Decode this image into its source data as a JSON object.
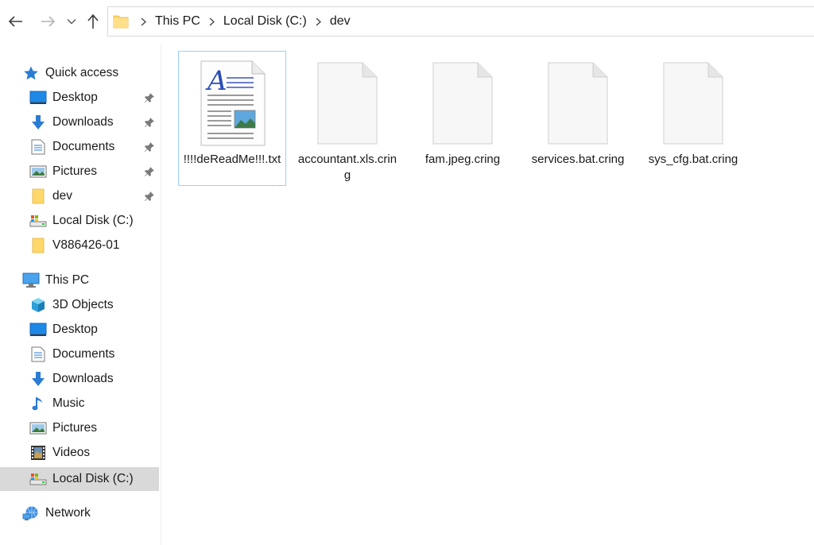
{
  "navigation": {
    "back_label": "Back",
    "forward_label": "Forward",
    "recent_label": "Recent locations",
    "up_label": "Up"
  },
  "address": {
    "crumbs": [
      "This PC",
      "Local Disk (C:)",
      "dev"
    ]
  },
  "sidebar": {
    "quick_access": {
      "label": "Quick access",
      "items": [
        {
          "label": "Desktop",
          "icon": "desktop-icon",
          "pinned": true
        },
        {
          "label": "Downloads",
          "icon": "downloads-icon",
          "pinned": true
        },
        {
          "label": "Documents",
          "icon": "documents-icon",
          "pinned": true
        },
        {
          "label": "Pictures",
          "icon": "pictures-icon",
          "pinned": true
        },
        {
          "label": "dev",
          "icon": "folder-icon",
          "pinned": true
        },
        {
          "label": "Local Disk (C:)",
          "icon": "drive-icon",
          "pinned": false
        },
        {
          "label": "V886426-01",
          "icon": "folder-icon",
          "pinned": false
        }
      ]
    },
    "this_pc": {
      "label": "This PC",
      "items": [
        {
          "label": "3D Objects",
          "icon": "3d-objects-icon"
        },
        {
          "label": "Desktop",
          "icon": "desktop-icon"
        },
        {
          "label": "Documents",
          "icon": "documents-icon"
        },
        {
          "label": "Downloads",
          "icon": "downloads-icon"
        },
        {
          "label": "Music",
          "icon": "music-icon"
        },
        {
          "label": "Pictures",
          "icon": "pictures-icon"
        },
        {
          "label": "Videos",
          "icon": "videos-icon"
        },
        {
          "label": "Local Disk (C:)",
          "icon": "drive-icon",
          "selected": true
        }
      ]
    },
    "network": {
      "label": "Network"
    }
  },
  "files": [
    {
      "name": "!!!!deReadMe!!!.txt",
      "icon": "text-document-icon",
      "selected": true
    },
    {
      "name": "accountant.xls.cring",
      "icon": "blank-file-icon",
      "selected": false
    },
    {
      "name": "fam.jpeg.cring",
      "icon": "blank-file-icon",
      "selected": false
    },
    {
      "name": "services.bat.cring",
      "icon": "blank-file-icon",
      "selected": false
    },
    {
      "name": "sys_cfg.bat.cring",
      "icon": "blank-file-icon",
      "selected": false
    }
  ],
  "colors": {
    "selection_border": "#99d1ff",
    "sidebar_selected": "#d9d9d9",
    "folder_yellow": "#ffd86b",
    "accent_blue": "#2b7cd3"
  }
}
